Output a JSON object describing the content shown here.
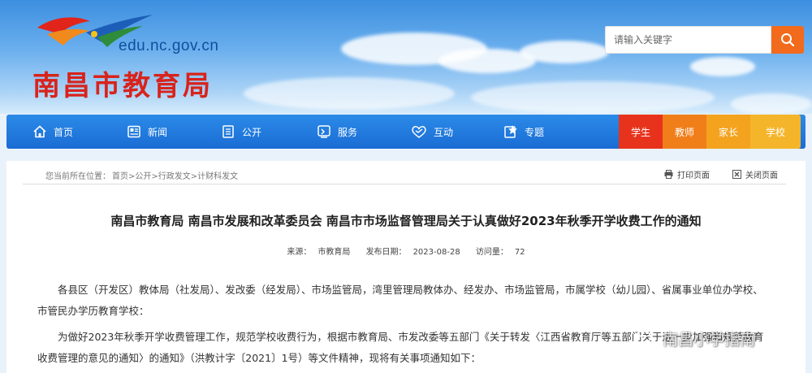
{
  "header": {
    "domain": "edu.nc.gov.cn",
    "title": "南昌市教育局",
    "search": {
      "placeholder": "请输入关键字"
    }
  },
  "nav": {
    "items": [
      {
        "label": "首页",
        "icon": "home-icon"
      },
      {
        "label": "新闻",
        "icon": "news-icon"
      },
      {
        "label": "公开",
        "icon": "list-icon"
      },
      {
        "label": "服务",
        "icon": "service-icon"
      },
      {
        "label": "互动",
        "icon": "heart-icon"
      },
      {
        "label": "专题",
        "icon": "topic-icon"
      }
    ],
    "audience": [
      {
        "label": "学生",
        "color": "#e8331c"
      },
      {
        "label": "教师",
        "color": "#f07f1a"
      },
      {
        "label": "家长",
        "color": "#f4a31e"
      },
      {
        "label": "学校",
        "color": "#f5b52a"
      }
    ]
  },
  "breadcrumb": {
    "label": "您当前所在位置：",
    "path": "首页>公开>行政发文>计财科发文"
  },
  "tools": {
    "print": "打印页面",
    "close": "关闭页面"
  },
  "article": {
    "title": "南昌市教育局 南昌市发展和改革委员会 南昌市市场监督管理局关于认真做好2023年秋季开学收费工作的通知",
    "source_label": "来源：",
    "source": "市教育局",
    "date_label": "发布日期：",
    "date": "2023-08-28",
    "views_label": "访问量：",
    "views": "72",
    "paragraphs": [
      "各县区（开发区）教体局（社发局）、发改委（经发局）、市场监管局，湾里管理局教体办、经发办、市场监管局，市属学校（幼儿园）、省属事业单位办学校、市管民办学历教育学校：",
      "为做好2023年秋季开学收费管理工作，规范学校收费行为，根据市教育局、市发改委等五部门《关于转发〈江西省教育厅等五部门关于进一步加强和规范教育收费管理的意见的通知〉的通知》（洪教计字〔2021〕1号）等文件精神，现将有关事项通知如下："
    ]
  },
  "watermark": "南昌小学指南",
  "colors": {
    "nav_blue": "#1a6cd4",
    "title_red": "#d8231c",
    "search_orange": "#f26a1b"
  }
}
